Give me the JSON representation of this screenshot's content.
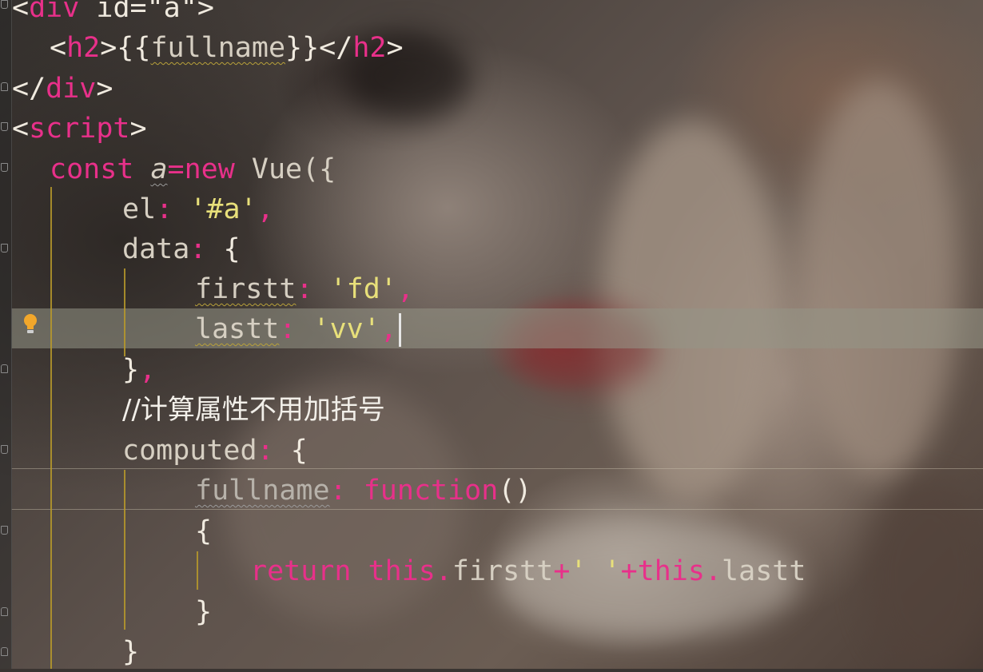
{
  "editor": {
    "lines": {
      "l0": {
        "open": "<",
        "tag": "div",
        "rest": " id=\"a\"",
        "close": ">"
      },
      "l1": {
        "open": "<",
        "tag": "h2",
        "mid": ">{{",
        "expr": "fullname",
        "mid2": "}}</",
        "tag2": "h2",
        "close": ">"
      },
      "l2": {
        "open": "</",
        "tag": "div",
        "close": ">"
      },
      "l3": {
        "open": "<",
        "tag": "script",
        "close": ">"
      },
      "l4": {
        "kw": "const",
        "sp": " ",
        "var": "a",
        "eq": "=",
        "kw2": "new",
        "rest": " Vue({"
      },
      "l5": {
        "key": "el",
        "colon": ":",
        "str": " '#a'",
        "comma": ","
      },
      "l6": {
        "key": "data",
        "colon": ":",
        "rest": " {"
      },
      "l7": {
        "key": "firstt",
        "colon": ":",
        "str": " 'fd'",
        "comma": ","
      },
      "l8": {
        "key": "lastt",
        "colon": ":",
        "str": " 'vv'",
        "comma": ","
      },
      "l9": {
        "brace": "}",
        "comma": ","
      },
      "l10": {
        "comment": "//计算属性不用加括号"
      },
      "l11": {
        "key": "computed",
        "colon": ":",
        "rest": " {"
      },
      "l12": {
        "key": "fullname",
        "colon": ":",
        "sp": " ",
        "kw": "function",
        "rest": "()"
      },
      "l13": {
        "brace": "{"
      },
      "l14": {
        "kw": "return",
        "sp": " ",
        "this1": "this.",
        "p1": "firstt",
        "plus1": "+",
        "str": "' '",
        "plus2": "+",
        "this2": "this.",
        "p2": "lastt"
      },
      "l15": {
        "brace": "}"
      },
      "l16": {
        "brace": "}"
      }
    }
  },
  "colors": {
    "tag": "#e8308a",
    "string": "#e8e07a",
    "guide": "#b89a2a",
    "bulb": "#f2a72b"
  }
}
